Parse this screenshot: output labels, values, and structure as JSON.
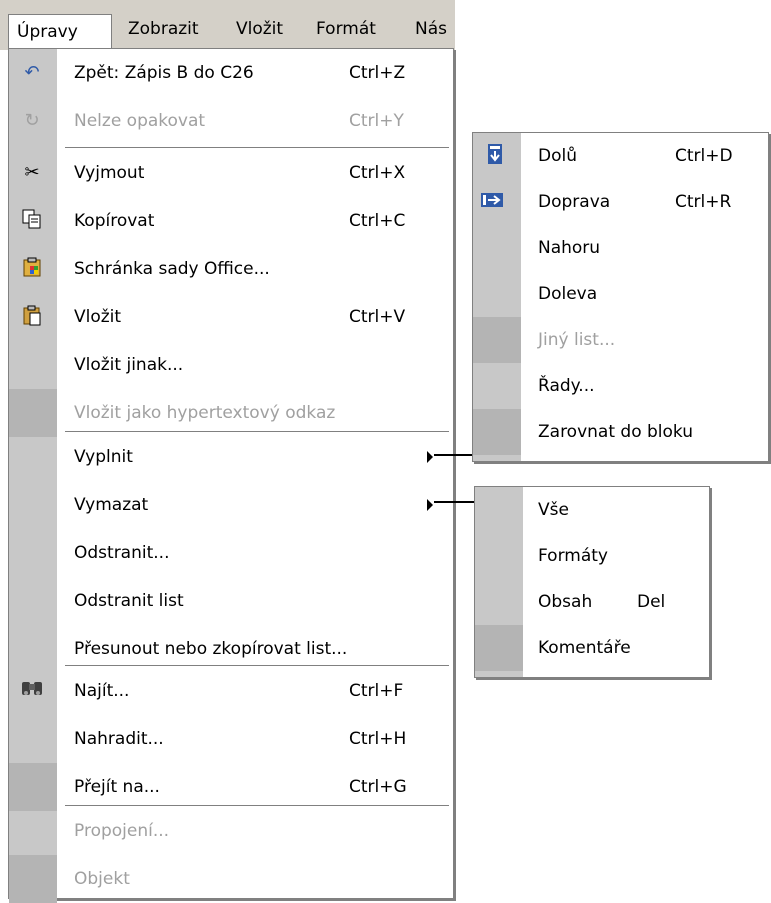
{
  "menubar": {
    "items": [
      {
        "label": "Úpravy",
        "active": true
      },
      {
        "label": "Zobrazit"
      },
      {
        "label": "Vložit"
      },
      {
        "label": "Formát"
      },
      {
        "label": "Nás"
      }
    ]
  },
  "main_menu": {
    "items": [
      {
        "icon": "undo-icon",
        "label": "Zpět: Zápis B do C26",
        "shortcut": "Ctrl+Z"
      },
      {
        "icon": "redo-icon",
        "label": "Nelze opakovat",
        "shortcut": "Ctrl+Y",
        "disabled": true
      },
      {
        "icon": "scissors-icon",
        "label": "Vyjmout",
        "shortcut": "Ctrl+X"
      },
      {
        "icon": "copy-icon",
        "label": "Kopírovat",
        "shortcut": "Ctrl+C"
      },
      {
        "icon": "office-clipboard-icon",
        "label": "Schránka sady Office..."
      },
      {
        "icon": "paste-icon",
        "label": "Vložit",
        "shortcut": "Ctrl+V"
      },
      {
        "label": "Vložit jinak..."
      },
      {
        "label": "Vložit jako hypertextový odkaz",
        "disabled": true
      },
      {
        "label": "Vyplnit",
        "submenu": true
      },
      {
        "label": "Vymazat",
        "submenu": true
      },
      {
        "label": "Odstranit..."
      },
      {
        "label": "Odstranit list"
      },
      {
        "label": "Přesunout nebo zkopírovat list..."
      },
      {
        "icon": "binoculars-icon",
        "label": "Najít...",
        "shortcut": "Ctrl+F"
      },
      {
        "label": "Nahradit...",
        "shortcut": "Ctrl+H"
      },
      {
        "label": "Přejít na...",
        "shortcut": "Ctrl+G"
      },
      {
        "label": "Propojení...",
        "disabled": true
      },
      {
        "label": "Objekt",
        "disabled": true
      }
    ]
  },
  "fill_submenu": {
    "items": [
      {
        "icon": "fill-down-icon",
        "label": "Dolů",
        "shortcut": "Ctrl+D"
      },
      {
        "icon": "fill-right-icon",
        "label": "Doprava",
        "shortcut": "Ctrl+R"
      },
      {
        "label": "Nahoru"
      },
      {
        "label": "Doleva"
      },
      {
        "label": "Jiný list...",
        "disabled": true
      },
      {
        "label": "Řady..."
      },
      {
        "label": "Zarovnat do bloku"
      }
    ]
  },
  "clear_submenu": {
    "items": [
      {
        "label": "Vše"
      },
      {
        "label": "Formáty"
      },
      {
        "label": "Obsah",
        "shortcut": "Del"
      },
      {
        "label": "Komentáře"
      }
    ]
  },
  "colors": {
    "menubar_bg": "#d4d0c8",
    "gutter": "#c8c8c8",
    "disabled_text": "#a0a0a0",
    "icon_blue": "#2f5aa8"
  }
}
